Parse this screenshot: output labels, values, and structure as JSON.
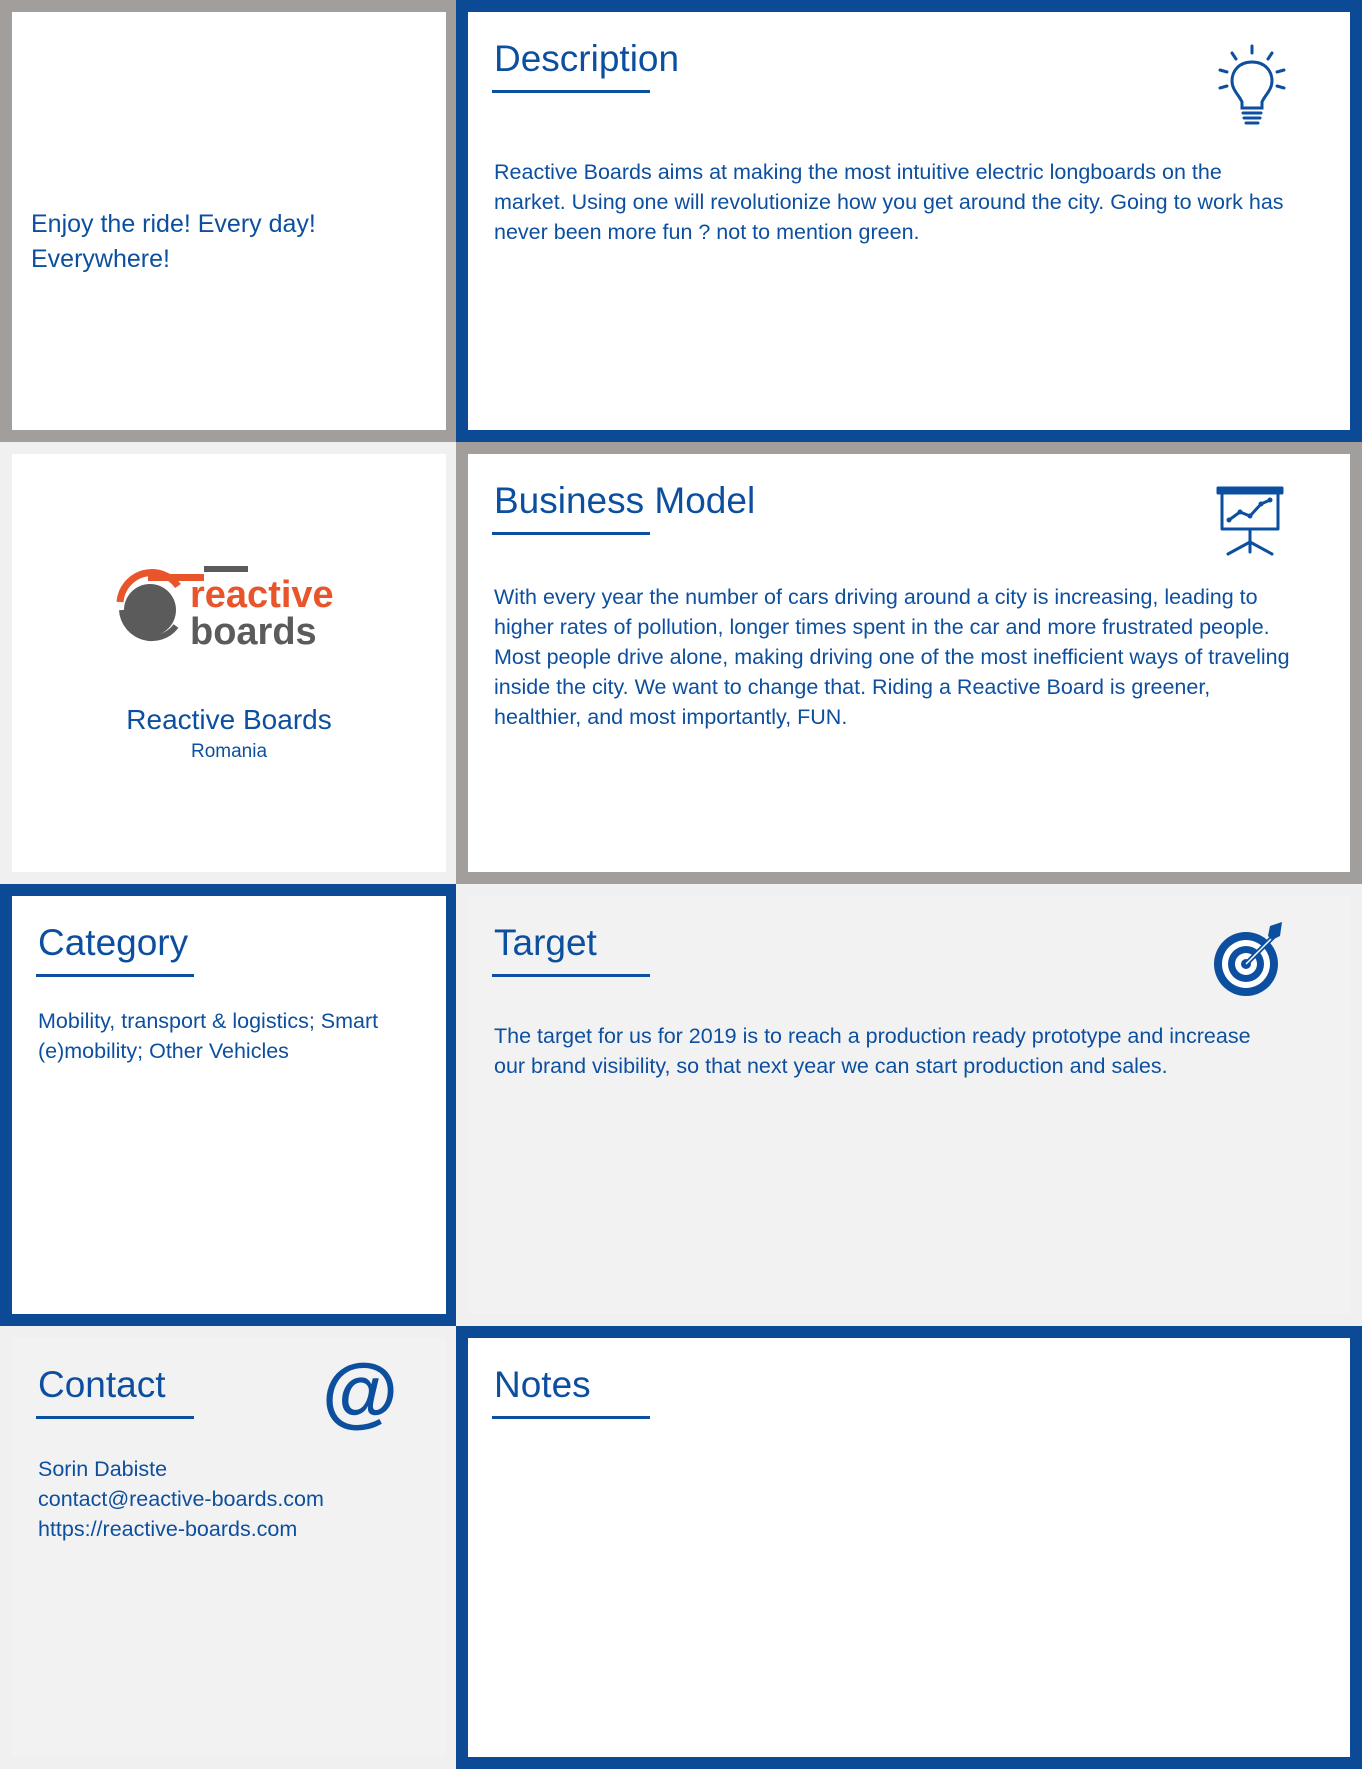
{
  "tagline": {
    "text": "Enjoy the ride! Every day! Everywhere!"
  },
  "description": {
    "heading": "Description",
    "icon": "lightbulb-icon",
    "body": "Reactive Boards aims at making the most intuitive electric longboards on the market. Using one will revolutionize how you get around the city. Going to work has never been more fun ? not to mention green."
  },
  "organization": {
    "logo": {
      "text_top": "reactive",
      "text_bottom": "boards",
      "accent_color": "#e8552a",
      "gray_color": "#5b5b5b"
    },
    "name": "Reactive Boards",
    "country": "Romania"
  },
  "business_model": {
    "heading": "Business Model",
    "icon": "presentation-chart-icon",
    "body": "With every year the number of cars driving around a city is increasing, leading to higher rates of pollution, longer times spent in the car and more frustrated people. Most people drive alone, making driving one of the most inefficient ways of traveling inside the city. We want to change that. Riding a Reactive Board is greener, healthier, and most importantly, FUN."
  },
  "category": {
    "heading": "Category",
    "body": "Mobility, transport & logistics; Smart (e)mobility; Other Vehicles"
  },
  "target": {
    "heading": "Target",
    "icon": "target-icon",
    "body": "The target for us for 2019 is to reach a production ready prototype and increase our brand visibility, so that next year we can start production and sales."
  },
  "contact": {
    "heading": "Contact",
    "icon": "at-sign-icon",
    "name": "Sorin Dabiste",
    "email": "contact@reactive-boards.com",
    "website": "https://reactive-boards.com"
  },
  "notes": {
    "heading": "Notes"
  },
  "colors": {
    "brand_blue": "#0d4f9f",
    "frame_blue": "#0d4a96",
    "frame_gray": "#a19e9c",
    "frame_light": "#f1f0f1"
  }
}
